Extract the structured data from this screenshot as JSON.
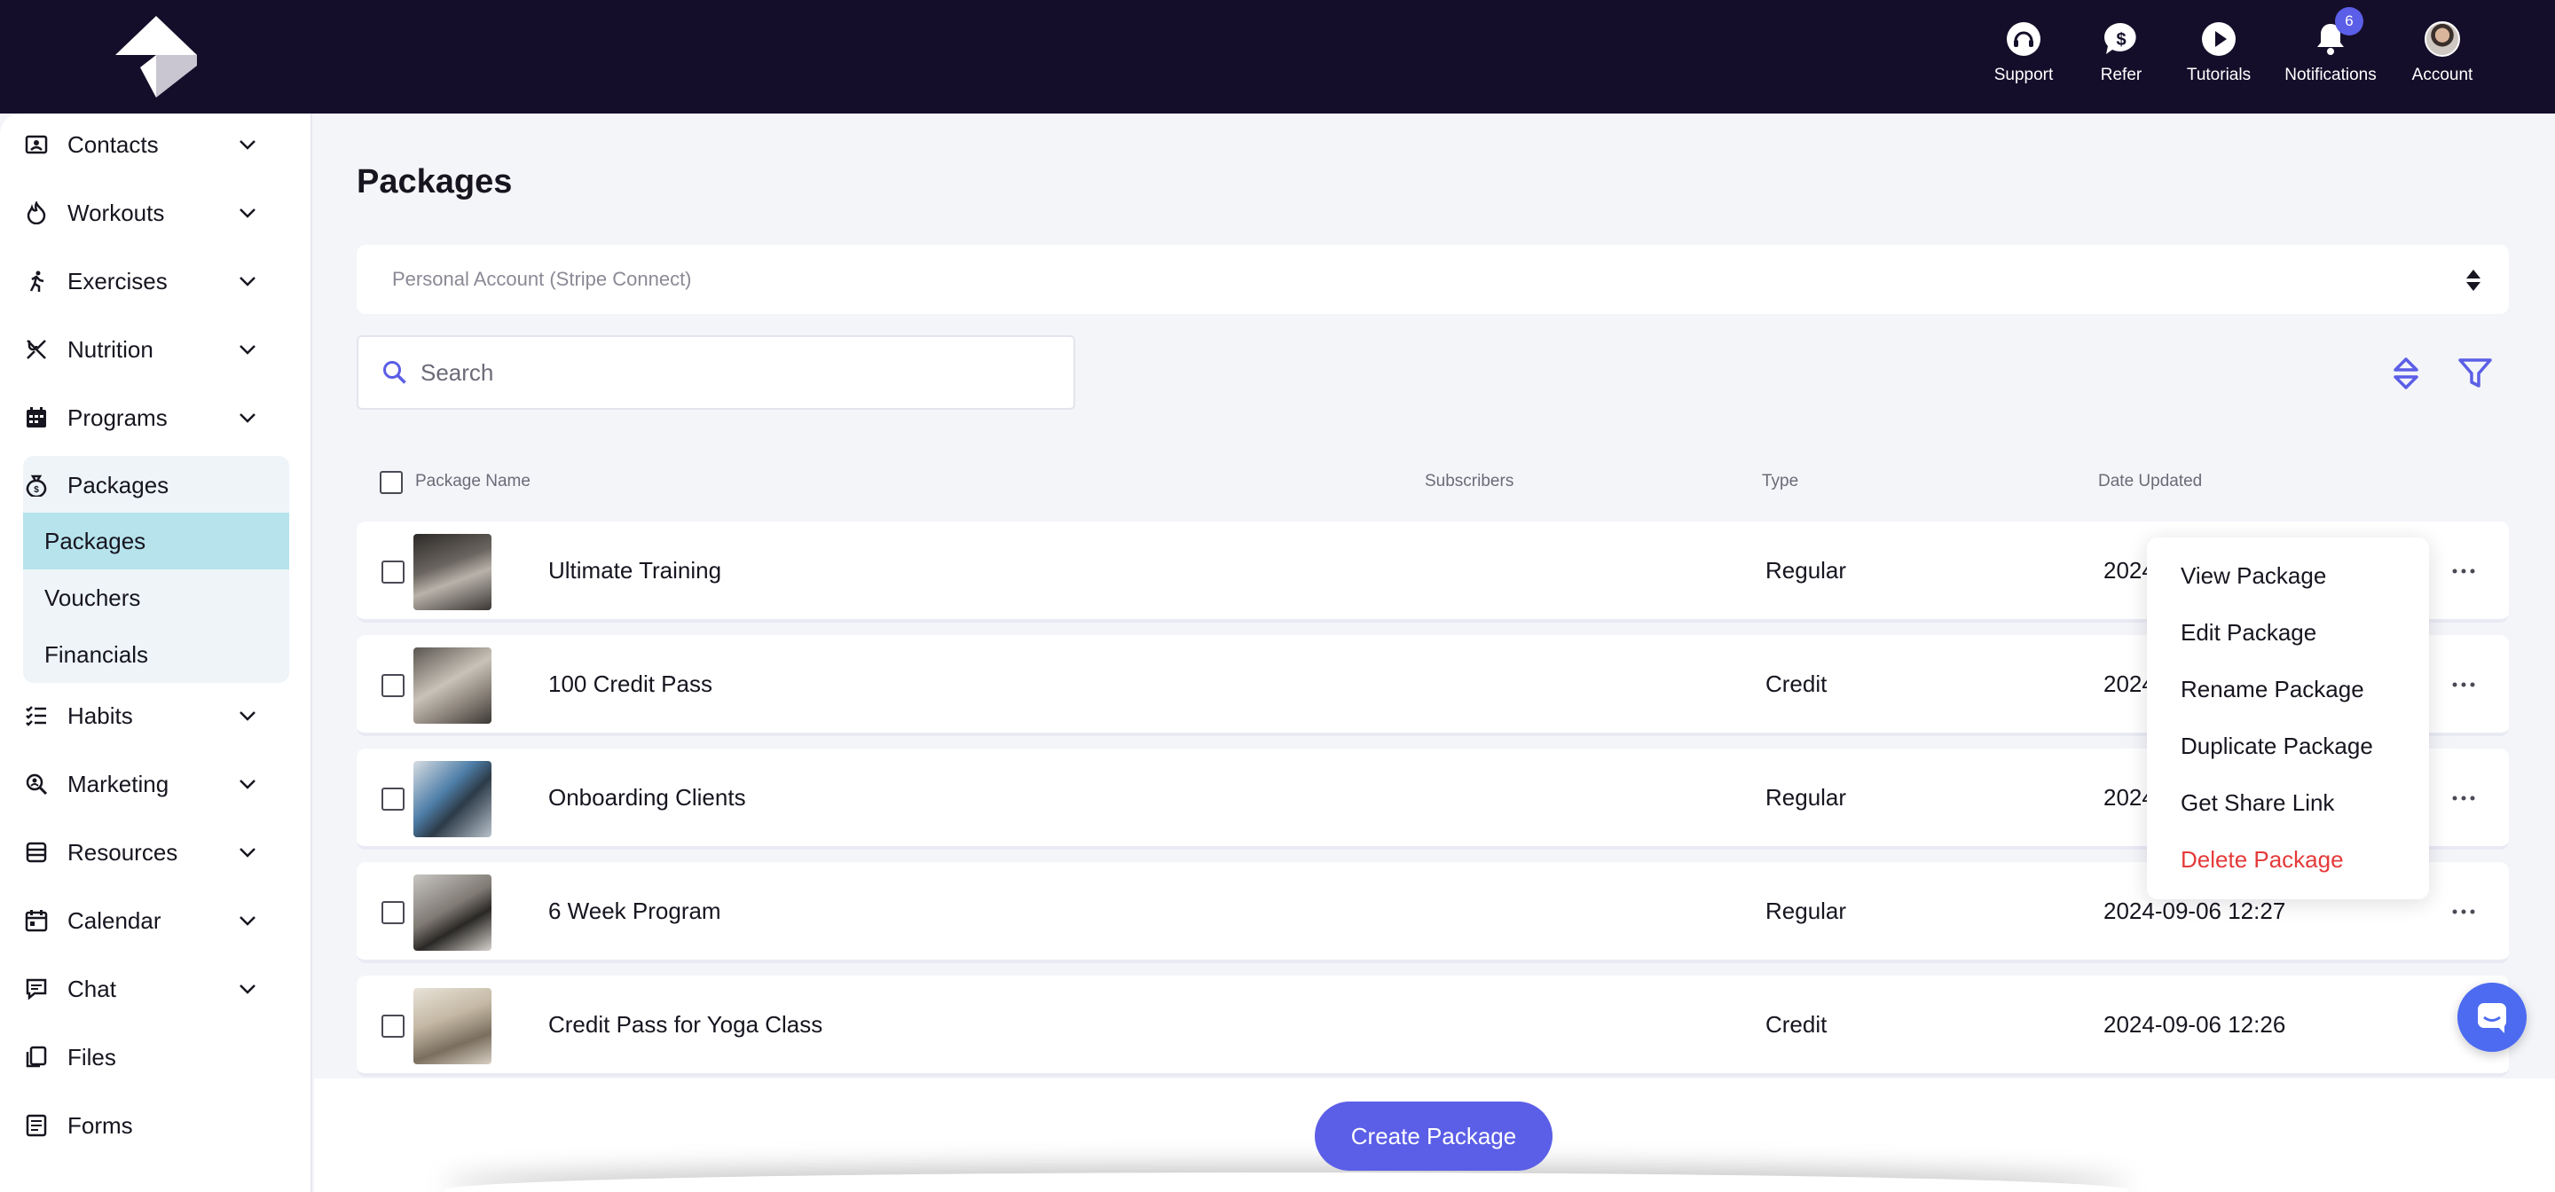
{
  "topnav": {
    "support": "Support",
    "refer": "Refer",
    "tutorials": "Tutorials",
    "notifications": "Notifications",
    "notifications_count": "6",
    "account": "Account"
  },
  "sidebar": {
    "items": [
      {
        "label": "Contacts",
        "icon": "contacts-icon"
      },
      {
        "label": "Workouts",
        "icon": "workouts-icon"
      },
      {
        "label": "Exercises",
        "icon": "exercises-icon"
      },
      {
        "label": "Nutrition",
        "icon": "nutrition-icon"
      },
      {
        "label": "Programs",
        "icon": "programs-icon"
      }
    ],
    "packages_group": {
      "label": "Packages",
      "sub_items": [
        "Packages",
        "Vouchers",
        "Financials"
      ],
      "active_sub": "Packages"
    },
    "items_after": [
      {
        "label": "Habits",
        "icon": "habits-icon"
      },
      {
        "label": "Marketing",
        "icon": "marketing-icon"
      },
      {
        "label": "Resources",
        "icon": "resources-icon"
      },
      {
        "label": "Calendar",
        "icon": "calendar-icon"
      },
      {
        "label": "Chat",
        "icon": "chat-icon"
      },
      {
        "label": "Files",
        "icon": "files-icon"
      },
      {
        "label": "Forms",
        "icon": "forms-icon"
      }
    ]
  },
  "main": {
    "title": "Packages",
    "account_select": "Personal Account (Stripe Connect)",
    "search_placeholder": "Search",
    "columns": {
      "name": "Package Name",
      "subscribers": "Subscribers",
      "type": "Type",
      "date": "Date Updated"
    },
    "rows": [
      {
        "name": "Ultimate Training",
        "type": "Regular",
        "date": "2024"
      },
      {
        "name": "100 Credit Pass",
        "type": "Credit",
        "date": "2024"
      },
      {
        "name": "Onboarding Clients",
        "type": "Regular",
        "date": "2024"
      },
      {
        "name": "6 Week Program",
        "type": "Regular",
        "date": "2024-09-06 12:27"
      },
      {
        "name": "Credit Pass for Yoga Class",
        "type": "Credit",
        "date": "2024-09-06 12:26"
      }
    ],
    "create_button": "Create Package"
  },
  "context_menu": {
    "items": [
      "View Package",
      "Edit Package",
      "Rename Package",
      "Duplicate Package",
      "Get Share Link",
      "Delete Package"
    ]
  },
  "colors": {
    "topbar": "#150e2a",
    "accent": "#5b5ee6",
    "active_sub": "#b6e3ec",
    "danger": "#e53a3a"
  }
}
